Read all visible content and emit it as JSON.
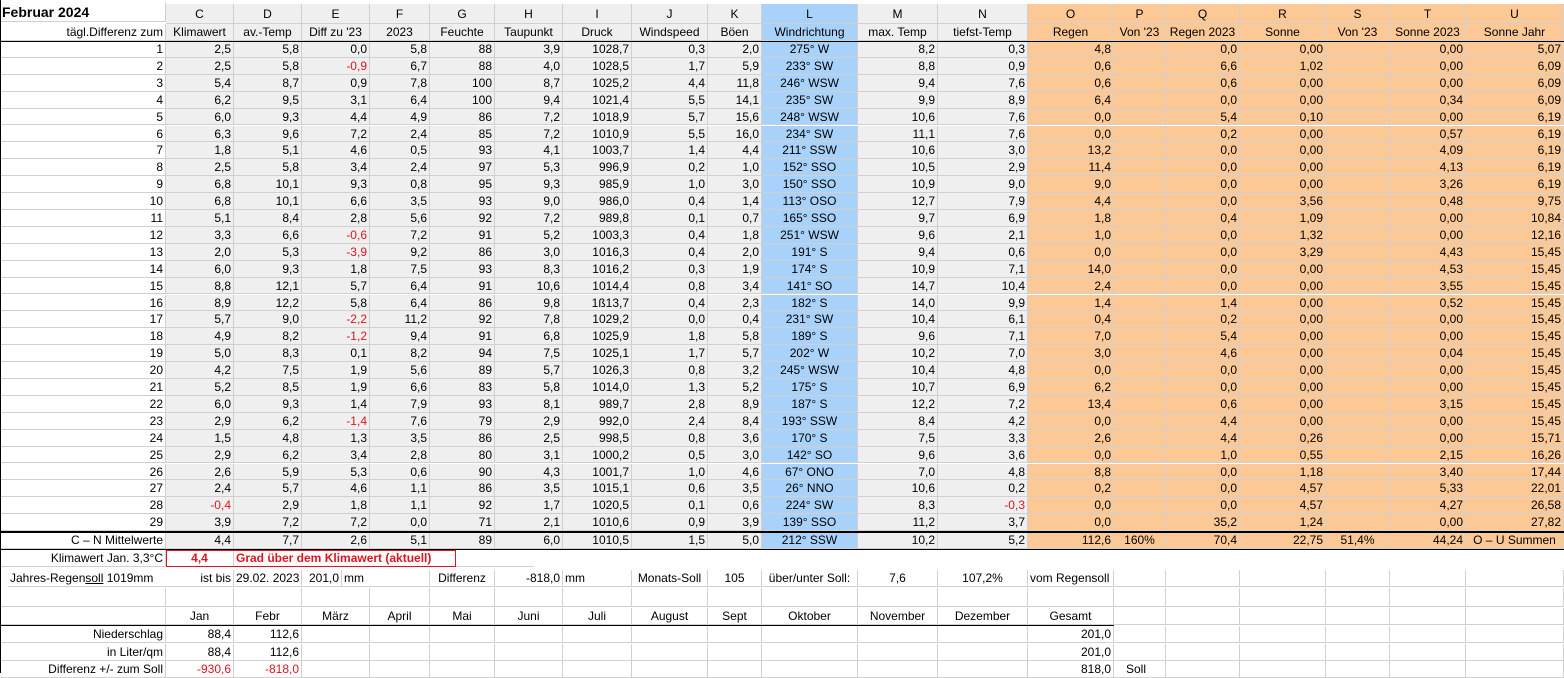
{
  "title": "Februar 2024",
  "column_letters": [
    "C",
    "D",
    "E",
    "F",
    "G",
    "H",
    "I",
    "J",
    "K",
    "L",
    "M",
    "N",
    "O",
    "P",
    "Q",
    "R",
    "S",
    "T",
    "U"
  ],
  "row_label_header": "tägl.Differenz zum",
  "headers": [
    "Klimawert",
    "av.-Temp",
    "Diff zu '23",
    "2023",
    "Feuchte",
    "Taupunkt",
    "Druck",
    "Windspeed",
    "Böen",
    "Windrichtung",
    "max. Temp",
    "tiefst-Temp",
    "Regen",
    "Von '23",
    "Regen 2023",
    "Sonne",
    "Von '23",
    "Sonne 2023",
    "Sonne Jahr"
  ],
  "rows": [
    {
      "day": "1",
      "C": "2,5",
      "D": "5,8",
      "E": "0,0",
      "F": "5,8",
      "G": "88",
      "H": "3,9",
      "I": "1028,7",
      "J": "0,3",
      "K": "2,0",
      "L": "275° W",
      "M": "8,2",
      "N": "0,3",
      "O": "4,8",
      "P": "",
      "Q": "0,0",
      "R": "0,00",
      "S": "",
      "T": "0,00",
      "U": "5,07"
    },
    {
      "day": "2",
      "C": "2,5",
      "D": "5,8",
      "E": "-0,9",
      "F": "6,7",
      "G": "88",
      "H": "4,0",
      "I": "1028,5",
      "J": "1,7",
      "K": "5,9",
      "L": "233° SW",
      "M": "8,8",
      "N": "0,9",
      "O": "0,6",
      "P": "",
      "Q": "6,6",
      "R": "1,02",
      "S": "",
      "T": "0,00",
      "U": "6,09"
    },
    {
      "day": "3",
      "C": "5,4",
      "D": "8,7",
      "E": "0,9",
      "F": "7,8",
      "G": "100",
      "H": "8,7",
      "I": "1025,2",
      "J": "4,4",
      "K": "11,8",
      "L": "246° WSW",
      "M": "9,4",
      "N": "7,6",
      "O": "0,6",
      "P": "",
      "Q": "0,6",
      "R": "0,00",
      "S": "",
      "T": "0,00",
      "U": "6,09"
    },
    {
      "day": "4",
      "C": "6,2",
      "D": "9,5",
      "E": "3,1",
      "F": "6,4",
      "G": "100",
      "H": "9,4",
      "I": "1021,4",
      "J": "5,5",
      "K": "14,1",
      "L": "235° SW",
      "M": "9,9",
      "N": "8,9",
      "O": "6,4",
      "P": "",
      "Q": "0,0",
      "R": "0,00",
      "S": "",
      "T": "0,34",
      "U": "6,09"
    },
    {
      "day": "5",
      "C": "6,0",
      "D": "9,3",
      "E": "4,4",
      "F": "4,9",
      "G": "86",
      "H": "7,2",
      "I": "1018,9",
      "J": "5,7",
      "K": "15,6",
      "L": "248° WSW",
      "M": "10,6",
      "N": "7,6",
      "O": "0,0",
      "P": "",
      "Q": "5,4",
      "R": "0,10",
      "S": "",
      "T": "0,00",
      "U": "6,19"
    },
    {
      "day": "6",
      "C": "6,3",
      "D": "9,6",
      "E": "7,2",
      "F": "2,4",
      "G": "85",
      "H": "7,2",
      "I": "1010,9",
      "J": "5,5",
      "K": "16,0",
      "L": "234° SW",
      "M": "11,1",
      "N": "7,6",
      "O": "0,0",
      "P": "",
      "Q": "0,2",
      "R": "0,00",
      "S": "",
      "T": "0,57",
      "U": "6,19"
    },
    {
      "day": "7",
      "C": "1,8",
      "D": "5,1",
      "E": "4,6",
      "F": "0,5",
      "G": "93",
      "H": "4,1",
      "I": "1003,7",
      "J": "1,4",
      "K": "4,4",
      "L": "211° SSW",
      "M": "10,6",
      "N": "3,0",
      "O": "13,2",
      "P": "",
      "Q": "0,0",
      "R": "0,00",
      "S": "",
      "T": "4,09",
      "U": "6,19"
    },
    {
      "day": "8",
      "C": "2,5",
      "D": "5,8",
      "E": "3,4",
      "F": "2,4",
      "G": "97",
      "H": "5,3",
      "I": "996,9",
      "J": "0,2",
      "K": "1,0",
      "L": "152° SSO",
      "M": "10,5",
      "N": "2,9",
      "O": "11,4",
      "P": "",
      "Q": "0,0",
      "R": "0,00",
      "S": "",
      "T": "4,13",
      "U": "6,19"
    },
    {
      "day": "9",
      "C": "6,8",
      "D": "10,1",
      "E": "9,3",
      "F": "0,8",
      "G": "95",
      "H": "9,3",
      "I": "985,9",
      "J": "1,0",
      "K": "3,0",
      "L": "150° SSO",
      "M": "10,9",
      "N": "9,0",
      "O": "9,0",
      "P": "",
      "Q": "0,0",
      "R": "0,00",
      "S": "",
      "T": "3,26",
      "U": "6,19"
    },
    {
      "day": "10",
      "C": "6,8",
      "D": "10,1",
      "E": "6,6",
      "F": "3,5",
      "G": "93",
      "H": "9,0",
      "I": "986,0",
      "J": "0,4",
      "K": "1,4",
      "L": "113° OSO",
      "M": "12,7",
      "N": "7,9",
      "O": "4,4",
      "P": "",
      "Q": "0,0",
      "R": "3,56",
      "S": "",
      "T": "0,48",
      "U": "9,75"
    },
    {
      "day": "11",
      "C": "5,1",
      "D": "8,4",
      "E": "2,8",
      "F": "5,6",
      "G": "92",
      "H": "7,2",
      "I": "989,8",
      "J": "0,1",
      "K": "0,7",
      "L": "165° SSO",
      "M": "9,7",
      "N": "6,9",
      "O": "1,8",
      "P": "",
      "Q": "0,4",
      "R": "1,09",
      "S": "",
      "T": "0,00",
      "U": "10,84"
    },
    {
      "day": "12",
      "C": "3,3",
      "D": "6,6",
      "E": "-0,6",
      "F": "7,2",
      "G": "91",
      "H": "5,2",
      "I": "1003,3",
      "J": "0,4",
      "K": "1,8",
      "L": "251° WSW",
      "M": "9,6",
      "N": "2,1",
      "O": "1,0",
      "P": "",
      "Q": "0,0",
      "R": "1,32",
      "S": "",
      "T": "0,00",
      "U": "12,16"
    },
    {
      "day": "13",
      "C": "2,0",
      "D": "5,3",
      "E": "-3,9",
      "F": "9,2",
      "G": "86",
      "H": "3,0",
      "I": "1016,3",
      "J": "0,4",
      "K": "2,0",
      "L": "191° S",
      "M": "9,4",
      "N": "0,6",
      "O": "0,0",
      "P": "",
      "Q": "0,0",
      "R": "3,29",
      "S": "",
      "T": "4,43",
      "U": "15,45"
    },
    {
      "day": "14",
      "C": "6,0",
      "D": "9,3",
      "E": "1,8",
      "F": "7,5",
      "G": "93",
      "H": "8,3",
      "I": "1016,2",
      "J": "0,3",
      "K": "1,9",
      "L": "174° S",
      "M": "10,9",
      "N": "7,1",
      "O": "14,0",
      "P": "",
      "Q": "0,0",
      "R": "0,00",
      "S": "",
      "T": "4,53",
      "U": "15,45"
    },
    {
      "day": "15",
      "C": "8,8",
      "D": "12,1",
      "E": "5,7",
      "F": "6,4",
      "G": "91",
      "H": "10,6",
      "I": "1014,4",
      "J": "0,8",
      "K": "3,4",
      "L": "141° SO",
      "M": "14,7",
      "N": "10,4",
      "O": "2,4",
      "P": "",
      "Q": "0,0",
      "R": "0,00",
      "S": "",
      "T": "3,55",
      "U": "15,45"
    },
    {
      "day": "16",
      "C": "8,9",
      "D": "12,2",
      "E": "5,8",
      "F": "6,4",
      "G": "86",
      "H": "9,8",
      "I": "1ß13,7",
      "J": "0,4",
      "K": "2,3",
      "L": "182° S",
      "M": "14,0",
      "N": "9,9",
      "O": "1,4",
      "P": "",
      "Q": "1,4",
      "R": "0,00",
      "S": "",
      "T": "0,52",
      "U": "15,45"
    },
    {
      "day": "17",
      "C": "5,7",
      "D": "9,0",
      "E": "-2,2",
      "F": "11,2",
      "G": "92",
      "H": "7,8",
      "I": "1029,2",
      "J": "0,0",
      "K": "0,4",
      "L": "231° SW",
      "M": "10,4",
      "N": "6,1",
      "O": "0,4",
      "P": "",
      "Q": "0,2",
      "R": "0,00",
      "S": "",
      "T": "0,00",
      "U": "15,45"
    },
    {
      "day": "18",
      "C": "4,9",
      "D": "8,2",
      "E": "-1,2",
      "F": "9,4",
      "G": "91",
      "H": "6,8",
      "I": "1025,9",
      "J": "1,8",
      "K": "5,8",
      "L": "189° S",
      "M": "9,6",
      "N": "7,1",
      "O": "7,0",
      "P": "",
      "Q": "5,4",
      "R": "0,00",
      "S": "",
      "T": "0,00",
      "U": "15,45"
    },
    {
      "day": "19",
      "C": "5,0",
      "D": "8,3",
      "E": "0,1",
      "F": "8,2",
      "G": "94",
      "H": "7,5",
      "I": "1025,1",
      "J": "1,7",
      "K": "5,7",
      "L": "202° W",
      "M": "10,2",
      "N": "7,0",
      "O": "3,0",
      "P": "",
      "Q": "4,6",
      "R": "0,00",
      "S": "",
      "T": "0,04",
      "U": "15,45"
    },
    {
      "day": "20",
      "C": "4,2",
      "D": "7,5",
      "E": "1,9",
      "F": "5,6",
      "G": "89",
      "H": "5,7",
      "I": "1026,3",
      "J": "0,8",
      "K": "3,2",
      "L": "245° WSW",
      "M": "10,4",
      "N": "4,8",
      "O": "0,0",
      "P": "",
      "Q": "0,0",
      "R": "0,00",
      "S": "",
      "T": "0,00",
      "U": "15,45"
    },
    {
      "day": "21",
      "C": "5,2",
      "D": "8,5",
      "E": "1,9",
      "F": "6,6",
      "G": "83",
      "H": "5,8",
      "I": "1014,0",
      "J": "1,3",
      "K": "5,2",
      "L": "175° S",
      "M": "10,7",
      "N": "6,9",
      "O": "6,2",
      "P": "",
      "Q": "0,0",
      "R": "0,00",
      "S": "",
      "T": "0,00",
      "U": "15,45"
    },
    {
      "day": "22",
      "C": "6,0",
      "D": "9,3",
      "E": "1,4",
      "F": "7,9",
      "G": "93",
      "H": "8,1",
      "I": "989,7",
      "J": "2,8",
      "K": "8,9",
      "L": "187° S",
      "M": "12,2",
      "N": "7,2",
      "O": "13,4",
      "P": "",
      "Q": "0,6",
      "R": "0,00",
      "S": "",
      "T": "3,15",
      "U": "15,45"
    },
    {
      "day": "23",
      "C": "2,9",
      "D": "6,2",
      "E": "-1,4",
      "F": "7,6",
      "G": "79",
      "H": "2,9",
      "I": "992,0",
      "J": "2,4",
      "K": "8,4",
      "L": "193° SSW",
      "M": "8,4",
      "N": "4,2",
      "O": "0,0",
      "P": "",
      "Q": "4,4",
      "R": "0,00",
      "S": "",
      "T": "0,00",
      "U": "15,45"
    },
    {
      "day": "24",
      "C": "1,5",
      "D": "4,8",
      "E": "1,3",
      "F": "3,5",
      "G": "86",
      "H": "2,5",
      "I": "998,5",
      "J": "0,8",
      "K": "3,6",
      "L": "170° S",
      "M": "7,5",
      "N": "3,3",
      "O": "2,6",
      "P": "",
      "Q": "4,4",
      "R": "0,26",
      "S": "",
      "T": "0,00",
      "U": "15,71"
    },
    {
      "day": "25",
      "C": "2,9",
      "D": "6,2",
      "E": "3,4",
      "F": "2,8",
      "G": "80",
      "H": "3,1",
      "I": "1000,2",
      "J": "0,5",
      "K": "3,0",
      "L": "142° SO",
      "M": "9,6",
      "N": "3,6",
      "O": "0,0",
      "P": "",
      "Q": "1,0",
      "R": "0,55",
      "S": "",
      "T": "2,15",
      "U": "16,26"
    },
    {
      "day": "26",
      "C": "2,6",
      "D": "5,9",
      "E": "5,3",
      "F": "0,6",
      "G": "90",
      "H": "4,3",
      "I": "1001,7",
      "J": "1,0",
      "K": "4,6",
      "L": "67° ONO",
      "M": "7,0",
      "N": "4,8",
      "O": "8,8",
      "P": "",
      "Q": "0,0",
      "R": "1,18",
      "S": "",
      "T": "3,40",
      "U": "17,44"
    },
    {
      "day": "27",
      "C": "2,4",
      "D": "5,7",
      "E": "4,6",
      "F": "1,1",
      "G": "86",
      "H": "3,5",
      "I": "1015,1",
      "J": "0,6",
      "K": "3,5",
      "L": "26° NNO",
      "M": "10,6",
      "N": "0,2",
      "O": "0,2",
      "P": "",
      "Q": "0,0",
      "R": "4,57",
      "S": "",
      "T": "5,33",
      "U": "22,01"
    },
    {
      "day": "28",
      "C": "-0,4",
      "D": "2,9",
      "E": "1,8",
      "F": "1,1",
      "G": "92",
      "H": "1,7",
      "I": "1020,5",
      "J": "0,1",
      "K": "0,6",
      "L": "224° SW",
      "M": "8,3",
      "N": "-0,3",
      "O": "0,0",
      "P": "",
      "Q": "0,0",
      "R": "4,57",
      "S": "",
      "T": "4,27",
      "U": "26,58"
    },
    {
      "day": "29",
      "C": "3,9",
      "D": "7,2",
      "E": "7,2",
      "F": "0,0",
      "G": "71",
      "H": "2,1",
      "I": "1010,6",
      "J": "0,9",
      "K": "3,9",
      "L": "139° SSO",
      "M": "11,2",
      "N": "3,7",
      "O": "0,0",
      "P": "",
      "Q": "35,2",
      "R": "1,24",
      "S": "",
      "T": "0,00",
      "U": "27,82"
    }
  ],
  "summary": {
    "label": "C – N Mittelwerte",
    "C": "4,4",
    "D": "7,7",
    "E": "2,6",
    "F": "5,1",
    "G": "89",
    "H": "6,0",
    "I": "1010,5",
    "J": "1,5",
    "K": "5,0",
    "L": "212° SSW",
    "M": "10,2",
    "N": "5,2",
    "O": "112,6",
    "P": "160%",
    "Q": "70,4",
    "R": "22,75",
    "S": "51,4%",
    "T": "44,24",
    "U": "O – U Summen"
  },
  "klimawert": {
    "label": "Klimawert Jan. 3,3°C",
    "value": "4,4",
    "note": "Grad über dem Klimawert (aktuell)"
  },
  "jahres": {
    "label_pre": "Jahres-Regen",
    "label_u": "soll",
    "label_post": " 1019mm",
    "ist_bis": "ist bis",
    "date": "29.02. 2023",
    "value": "201,0",
    "unit": "mm",
    "diff_label": "Differenz",
    "diff_value": "-818,0",
    "diff_unit": "mm",
    "monats_label": "Monats-Soll",
    "monats_value": "105",
    "ueber_label": "über/unter Soll:",
    "ueber_value": "7,6",
    "pct": "107,2%",
    "vom": "vom Regensoll"
  },
  "months": [
    "Jan",
    "Febr",
    "März",
    "April",
    "Mai",
    "Juni",
    "Juli",
    "August",
    "Sept",
    "Oktober",
    "November",
    "Dezember",
    "Gesamt"
  ],
  "niederschlag": {
    "label": "Niederschlag",
    "values": [
      "88,4",
      "112,6"
    ],
    "gesamt": "201,0"
  },
  "liter": {
    "label": "in Liter/qm",
    "values": [
      "88,4",
      "112,6"
    ],
    "gesamt": "201,0"
  },
  "differenz": {
    "label": "Differenz  +/- zum Soll",
    "values": [
      "-930,6",
      "-818,0"
    ],
    "gesamt": "818,0",
    "soll": "Soll"
  }
}
